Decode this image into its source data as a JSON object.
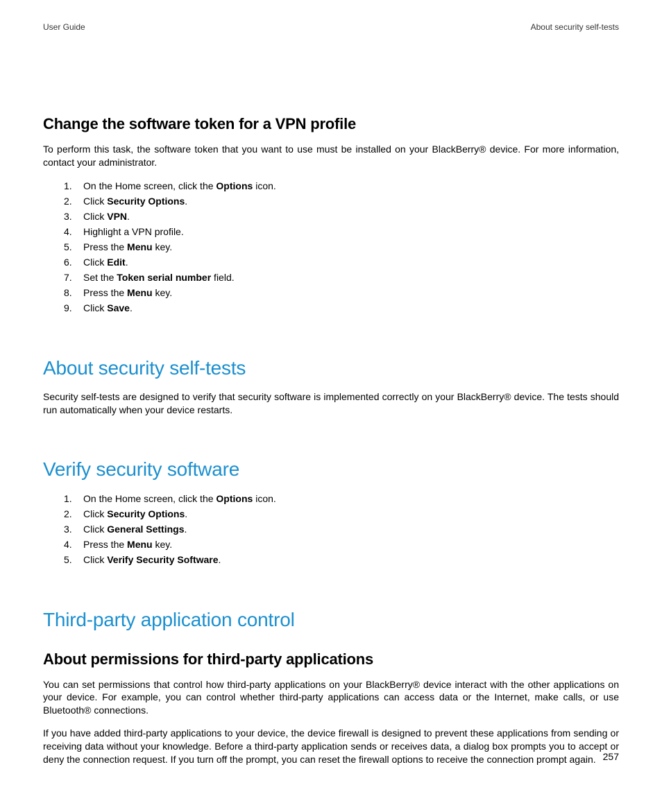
{
  "header": {
    "left": "User Guide",
    "right": "About security self-tests"
  },
  "section1": {
    "title": "Change the software token for a VPN profile",
    "intro": "To perform this task, the software token that you want to use must be installed on your BlackBerry® device. For more information, contact your administrator.",
    "steps": [
      {
        "pre": "On the Home screen, click the ",
        "bold": "Options",
        "post": " icon."
      },
      {
        "pre": "Click ",
        "bold": "Security Options",
        "post": "."
      },
      {
        "pre": "Click ",
        "bold": "VPN",
        "post": "."
      },
      {
        "pre": "Highlight a VPN profile.",
        "bold": "",
        "post": ""
      },
      {
        "pre": "Press the ",
        "bold": "Menu",
        "post": " key."
      },
      {
        "pre": "Click ",
        "bold": "Edit",
        "post": "."
      },
      {
        "pre": "Set the ",
        "bold": "Token serial number",
        "post": " field."
      },
      {
        "pre": "Press the ",
        "bold": "Menu",
        "post": " key."
      },
      {
        "pre": "Click ",
        "bold": "Save",
        "post": "."
      }
    ]
  },
  "section2": {
    "title": "About security self-tests",
    "body": "Security self-tests are designed to verify that security software is implemented correctly on your BlackBerry® device. The tests should run automatically when your device restarts."
  },
  "section3": {
    "title": "Verify security software",
    "steps": [
      {
        "pre": "On the Home screen, click the ",
        "bold": "Options",
        "post": " icon."
      },
      {
        "pre": "Click ",
        "bold": "Security Options",
        "post": "."
      },
      {
        "pre": "Click ",
        "bold": "General Settings",
        "post": "."
      },
      {
        "pre": "Press the ",
        "bold": "Menu",
        "post": " key."
      },
      {
        "pre": "Click ",
        "bold": "Verify Security Software",
        "post": "."
      }
    ]
  },
  "section4": {
    "title": "Third-party application control",
    "subhead": "About permissions for third-party applications",
    "para1": "You can set permissions that control how third-party applications on your BlackBerry® device interact with the other applications on your device. For example, you can control whether third-party applications can access data or the Internet, make calls, or use Bluetooth® connections.",
    "para2": "If you have added third-party applications to your device, the device firewall is designed to prevent these applications from sending or receiving data without your knowledge. Before a third-party application sends or receives data, a dialog box prompts you to accept or deny the connection request. If you turn off the prompt, you can reset the firewall options to receive the connection prompt again."
  },
  "pageNumber": "257"
}
